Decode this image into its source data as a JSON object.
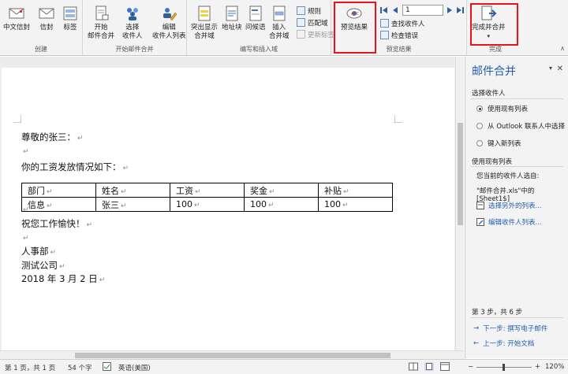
{
  "ribbon": {
    "groups": {
      "create": "创建",
      "start": "开始邮件合并",
      "write": "编写和插入域",
      "preview": "预览结果",
      "finish": "完成"
    },
    "buttons": {
      "envelope_cn": "中文信封",
      "envelope": "信封",
      "labels": "标签",
      "start_merge_1": "开始",
      "start_merge_2": "邮件合并",
      "select_recipients_1": "选择",
      "select_recipients_2": "收件人",
      "edit_list_1": "编辑",
      "edit_list_2": "收件人列表",
      "highlight_1": "突出显示",
      "highlight_2": "合并域",
      "address_block": "地址块",
      "greeting": "问候语",
      "insert_field_1": "插入",
      "insert_field_2": "合并域",
      "rules": "规则",
      "match_fields": "匹配域",
      "update_labels": "更新标签",
      "preview_results": "预览结果",
      "record_number": "1",
      "find_recipient": "查找收件人",
      "check_errors": "检查错误",
      "finish_merge": "完成并合并"
    }
  },
  "document": {
    "greeting": "尊敬的张三：",
    "intro": "你的工资发放情况如下：",
    "table": {
      "headers": [
        "部门",
        "姓名",
        "工资",
        "奖金",
        "补贴"
      ],
      "row": [
        "信息",
        "张三",
        "100",
        "100",
        "100"
      ]
    },
    "wish": "祝您工作愉快！",
    "dept": "人事部",
    "company": "测试公司",
    "date": "2018 年 3 月 2 日",
    "para_mark": "↵"
  },
  "pane": {
    "title": "邮件合并",
    "select_recipients": "选择收件人",
    "options": [
      "使用现有列表",
      "从 Outlook 联系人中选择",
      "键入新列表"
    ],
    "use_existing": "使用现有列表",
    "current_from": "您当前的收件人选自:",
    "current_source": "\"邮件合并.xls\"中的 [Sheet1$]",
    "choose_other": "选择另外的列表...",
    "edit_list": "编辑收件人列表...",
    "step": "第 3 步，共 6 步",
    "next": "下一步: 撰写电子邮件",
    "prev": "上一步: 开始文档"
  },
  "status": {
    "page": "第 1 页，共 1 页",
    "words": "54 个字",
    "language": "英语(美国)",
    "zoom": "120%"
  },
  "colors": {
    "accent": "#1f5fb0",
    "highlight": "#e8141b"
  }
}
